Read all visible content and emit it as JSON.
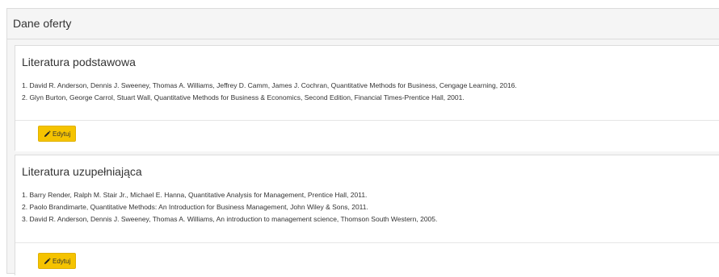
{
  "panel": {
    "title": "Dane oferty"
  },
  "sections": [
    {
      "title": "Literatura podstawowa",
      "items": [
        "1. David R. Anderson, Dennis J. Sweeney, Thomas A. Williams, Jeffrey D. Camm, James J. Cochran, Quantitative Methods for Business, Cengage Learning, 2016.",
        "2. Glyn Burton, George Carrol, Stuart Wall, Quantitative Methods for Business & Economics, Second Edition, Financial Times-Prentice Hall, 2001."
      ],
      "edit_label": "Edytuj"
    },
    {
      "title": "Literatura uzupełniająca",
      "items": [
        "1. Barry Render, Ralph M. Stair Jr., Michael E. Hanna, Quantitative Analysis for Management, Prentice Hall, 2011.",
        "2. Paolo Brandimarte, Quantitative Methods: An Introduction for Business Management, John Wiley & Sons, 2011.",
        "3. David R. Anderson, Dennis J. Sweeney, Thomas A. Williams, An introduction to management science, Thomson South Western, 2005."
      ],
      "edit_label": "Edytuj"
    }
  ],
  "colors": {
    "edit_button": "#f5c300",
    "border": "#dcdcdc",
    "header_bg": "#f5f5f5"
  },
  "icons": {
    "edit": "pencil-icon"
  }
}
